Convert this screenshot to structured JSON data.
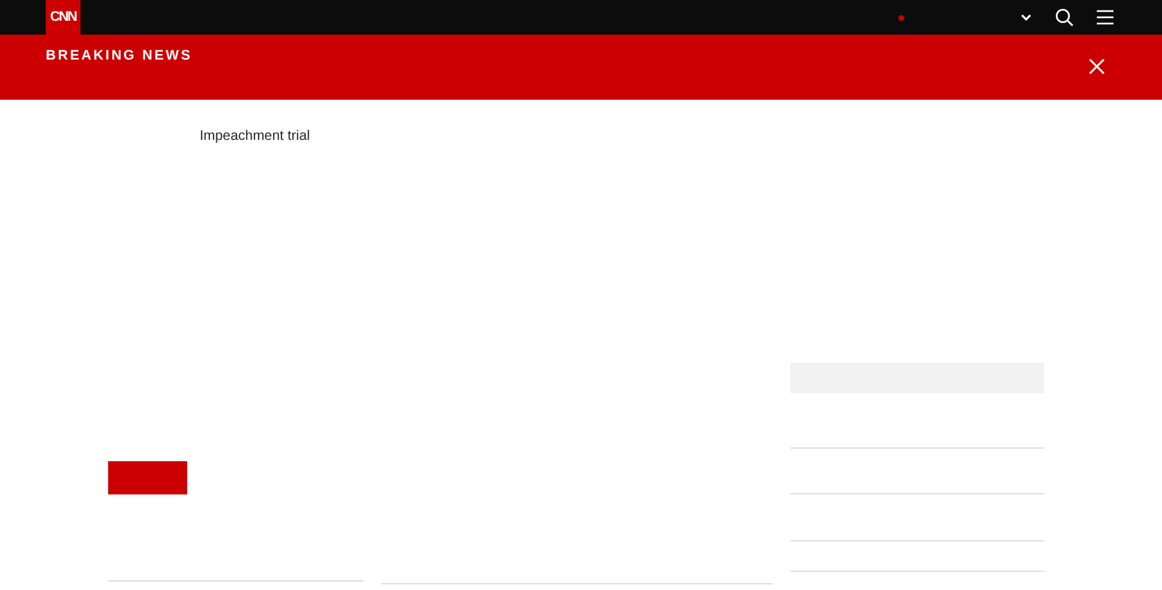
{
  "header": {
    "logo": "CNN"
  },
  "breaking_banner": {
    "label": "BREAKING NEWS"
  },
  "topic_link": "Impeachment trial"
}
